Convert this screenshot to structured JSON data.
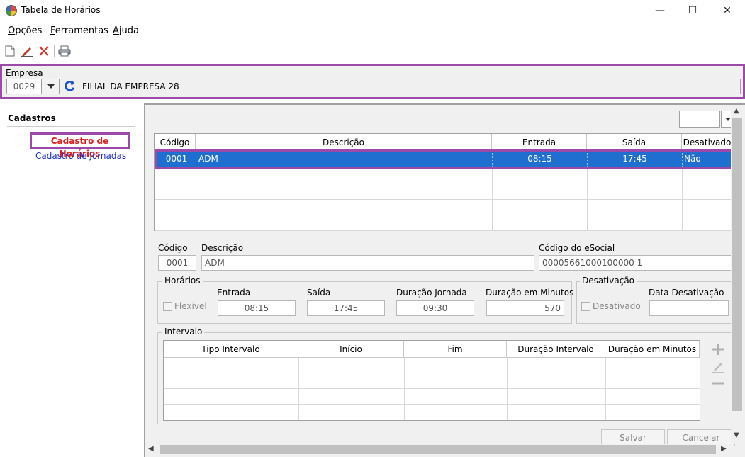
{
  "window": {
    "title": "Tabela de Horários",
    "minimize": "—",
    "maximize": "☐",
    "close": "✕"
  },
  "menu": [
    "Opções",
    "Ferramentas",
    "Ajuda"
  ],
  "toolbar": {
    "icons": [
      "new-document-icon",
      "edit-pencil-icon",
      "delete-x-icon",
      "print-icon"
    ]
  },
  "empresa": {
    "label": "Empresa",
    "code": "0029",
    "name": "FILIAL DA EMPRESA 28"
  },
  "sidebar": {
    "title": "Cadastros",
    "items": [
      {
        "label": "Cadastro de Horários",
        "selected": true
      },
      {
        "label": "Cadastro de Jornadas",
        "selected": false
      }
    ]
  },
  "grid": {
    "columns": [
      "Código",
      "Descrição",
      "Entrada",
      "Saída",
      "Desativado"
    ],
    "rows": [
      {
        "codigo": "0001",
        "descricao": "ADM",
        "entrada": "08:15",
        "saida": "17:45",
        "desativado": "Não"
      }
    ]
  },
  "form": {
    "codigo_label": "Código",
    "codigo": "0001",
    "descricao_label": "Descrição",
    "descricao": "ADM",
    "esocial_label": "Código do eSocial",
    "esocial": "00005661000100000 1",
    "horarios": {
      "title": "Horários",
      "flexivel_label": "Flexível",
      "entrada_label": "Entrada",
      "entrada": "08:15",
      "saida_label": "Saída",
      "saida": "17:45",
      "duracao_label": "Duração Jornada",
      "duracao": "09:30",
      "minutos_label": "Duração em Minutos",
      "minutos": "570"
    },
    "desativacao": {
      "title": "Desativação",
      "desativado_label": "Desativado",
      "data_label": "Data Desativação",
      "data": ""
    },
    "intervalo": {
      "title": "Intervalo",
      "columns": [
        "Tipo Intervalo",
        "Início",
        "Fim",
        "Duração Intervalo",
        "Duração em Minutos"
      ]
    }
  },
  "buttons": {
    "salvar": "Salvar",
    "cancelar": "Cancelar"
  }
}
